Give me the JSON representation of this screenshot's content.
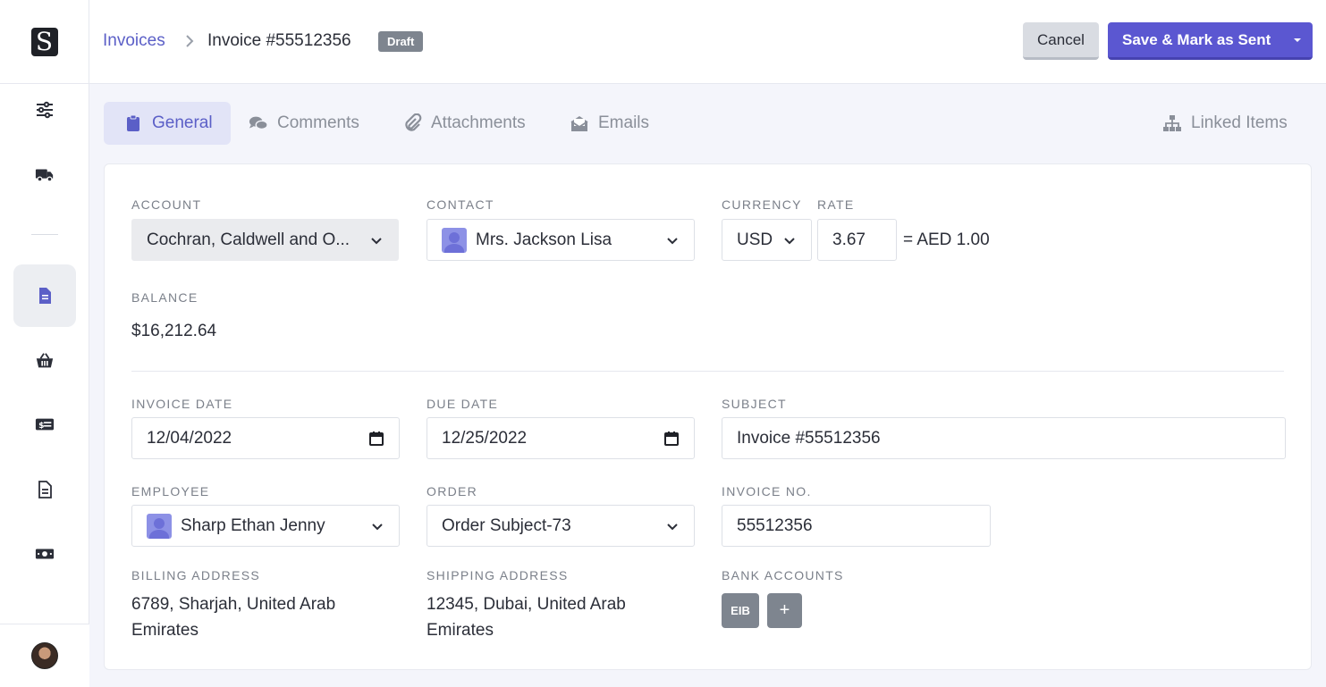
{
  "sidebar": {
    "logo_letter": "S",
    "items": [
      {
        "icon": "sliders-icon"
      },
      {
        "icon": "truck-icon"
      },
      {
        "icon": "invoice-icon",
        "active": true
      },
      {
        "icon": "basket-icon"
      },
      {
        "icon": "money-card-icon"
      },
      {
        "icon": "document-icon"
      },
      {
        "icon": "cash-icon"
      },
      {
        "icon": "coin-icon"
      }
    ]
  },
  "header": {
    "breadcrumb_link": "Invoices",
    "breadcrumb_current": "Invoice #55512356",
    "status_badge": "Draft",
    "cancel_label": "Cancel",
    "save_label": "Save & Mark as Sent"
  },
  "tabs": [
    {
      "label": "General",
      "icon": "clipboard-icon",
      "active": true
    },
    {
      "label": "Comments",
      "icon": "comments-icon"
    },
    {
      "label": "Attachments",
      "icon": "paperclip-icon"
    },
    {
      "label": "Emails",
      "icon": "envelope-open-icon"
    },
    {
      "label": "Linked Items",
      "icon": "sitemap-icon"
    }
  ],
  "form": {
    "account": {
      "label": "ACCOUNT",
      "value": "Cochran, Caldwell and O..."
    },
    "contact": {
      "label": "CONTACT",
      "value": "Mrs. Jackson Lisa"
    },
    "currency": {
      "label": "CURRENCY",
      "value": "USD"
    },
    "rate": {
      "label": "RATE",
      "value": "3.67",
      "conversion": "= AED 1.00"
    },
    "balance": {
      "label": "BALANCE",
      "value": "$16,212.64"
    },
    "invoice_date": {
      "label": "INVOICE DATE",
      "value": "12/04/2022"
    },
    "due_date": {
      "label": "DUE DATE",
      "value": "12/25/2022"
    },
    "subject": {
      "label": "SUBJECT",
      "value": "Invoice #55512356"
    },
    "employee": {
      "label": "EMPLOYEE",
      "value": "Sharp Ethan Jenny"
    },
    "order": {
      "label": "ORDER",
      "value": "Order Subject-73"
    },
    "invoice_no": {
      "label": "INVOICE NO.",
      "value": "55512356"
    },
    "billing_address": {
      "label": "BILLING ADDRESS",
      "line1": "6789, Sharjah, United Arab",
      "line2": "Emirates"
    },
    "shipping_address": {
      "label": "SHIPPING ADDRESS",
      "line1": "12345, Dubai, United Arab",
      "line2": "Emirates"
    },
    "bank_accounts": {
      "label": "BANK ACCOUNTS",
      "items": [
        "EIB"
      ],
      "add_label": "+"
    }
  },
  "colors": {
    "accent": "#5b57d1",
    "badge": "#7e858f"
  }
}
